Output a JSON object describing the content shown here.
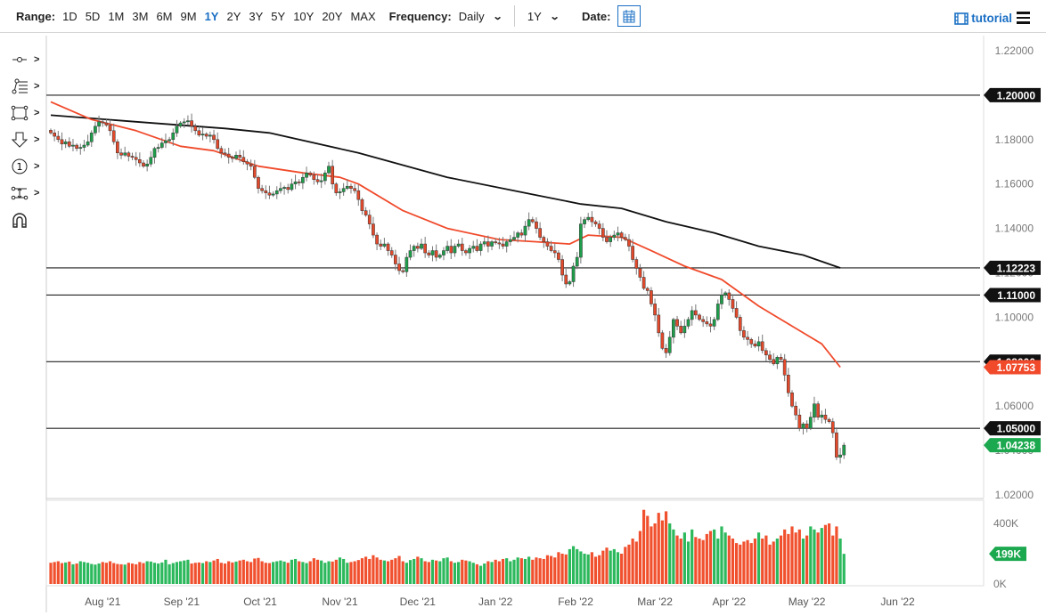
{
  "toolbar": {
    "range_label": "Range:",
    "ranges": [
      "1D",
      "5D",
      "1M",
      "3M",
      "6M",
      "9M",
      "1Y",
      "2Y",
      "3Y",
      "5Y",
      "10Y",
      "20Y",
      "MAX"
    ],
    "selected_range": "1Y",
    "frequency_label": "Frequency:",
    "frequency_value": "Daily",
    "period_value": "1Y",
    "date_label": "Date:",
    "tutorial_label": "tutorial"
  },
  "tools": [
    "line-tool-icon",
    "fibonacci-tool-icon",
    "rectangle-tool-icon",
    "arrow-down-tool-icon",
    "number-marker-icon",
    "measure-tool-icon",
    "magnet-icon"
  ],
  "colors": {
    "up": "#1e9e4a",
    "down": "#e3492b",
    "ma_fast": "#f04a2b",
    "ma_slow": "#111111",
    "accent": "#1a6fc4"
  },
  "chart_data": {
    "type": "candlestick",
    "ylim": [
      1.015,
      1.225
    ],
    "price_ticks": [
      "1.22000",
      "1.20000",
      "1.18000",
      "1.16000",
      "1.14000",
      "1.12000",
      "1.10000",
      "1.08000",
      "1.06000",
      "1.04000",
      "1.02000"
    ],
    "x_labels": [
      {
        "label": "Aug '21",
        "i": 14
      },
      {
        "label": "Sep '21",
        "i": 35.3
      },
      {
        "label": "Oct '21",
        "i": 56.5
      },
      {
        "label": "Nov '21",
        "i": 78
      },
      {
        "label": "Dec '21",
        "i": 99
      },
      {
        "label": "Jan '22",
        "i": 120
      },
      {
        "label": "Feb '22",
        "i": 141.6
      },
      {
        "label": "Mar '22",
        "i": 163
      },
      {
        "label": "Apr '22",
        "i": 183
      },
      {
        "label": "May '22",
        "i": 204
      },
      {
        "label": "Jun '22",
        "i": 228.5
      }
    ],
    "horizontal_lines": [
      {
        "value": 1.2,
        "label": "1.20000"
      },
      {
        "value": 1.12223,
        "label": "1.12223"
      },
      {
        "value": 1.11,
        "label": "1.11000"
      },
      {
        "value": 1.08,
        "label": "1.08000"
      },
      {
        "value": 1.05,
        "label": "1.05000"
      }
    ],
    "ma_fast": {
      "label": "1.07753",
      "points": [
        [
          0,
          1.197
        ],
        [
          11,
          1.189
        ],
        [
          23,
          1.184
        ],
        [
          35,
          1.177
        ],
        [
          44,
          1.175
        ],
        [
          56,
          1.168
        ],
        [
          68,
          1.165
        ],
        [
          78,
          1.163
        ],
        [
          83,
          1.16
        ],
        [
          95,
          1.148
        ],
        [
          107,
          1.14
        ],
        [
          121,
          1.135
        ],
        [
          131,
          1.134
        ],
        [
          140,
          1.133
        ],
        [
          145,
          1.137
        ],
        [
          154,
          1.136
        ],
        [
          162,
          1.13
        ],
        [
          171,
          1.123
        ],
        [
          181,
          1.117
        ],
        [
          191,
          1.105
        ],
        [
          198,
          1.098
        ],
        [
          208,
          1.088
        ],
        [
          213,
          1.0775
        ]
      ]
    },
    "ma_slow": {
      "points": [
        [
          0,
          1.191
        ],
        [
          23,
          1.188
        ],
        [
          47,
          1.185
        ],
        [
          59,
          1.183
        ],
        [
          83,
          1.174
        ],
        [
          107,
          1.163
        ],
        [
          131,
          1.155
        ],
        [
          143,
          1.151
        ],
        [
          154,
          1.149
        ],
        [
          166,
          1.143
        ],
        [
          179,
          1.138
        ],
        [
          191,
          1.132
        ],
        [
          203,
          1.128
        ],
        [
          213,
          1.1222
        ]
      ]
    },
    "last_price": "1.04238",
    "closes": [
      1.183,
      1.1815,
      1.18,
      1.178,
      1.179,
      1.177,
      1.1775,
      1.176,
      1.1765,
      1.1775,
      1.179,
      1.183,
      1.186,
      1.188,
      1.1875,
      1.1865,
      1.184,
      1.179,
      1.174,
      1.173,
      1.174,
      1.1725,
      1.172,
      1.171,
      1.1695,
      1.168,
      1.169,
      1.172,
      1.176,
      1.1765,
      1.1785,
      1.1795,
      1.18,
      1.183,
      1.186,
      1.1875,
      1.188,
      1.1885,
      1.186,
      1.184,
      1.182,
      1.1825,
      1.1815,
      1.182,
      1.18,
      1.176,
      1.174,
      1.1735,
      1.172,
      1.1715,
      1.173,
      1.172,
      1.17,
      1.169,
      1.168,
      1.163,
      1.158,
      1.157,
      1.156,
      1.155,
      1.1555,
      1.157,
      1.158,
      1.1585,
      1.1575,
      1.16,
      1.161,
      1.1605,
      1.163,
      1.165,
      1.164,
      1.162,
      1.161,
      1.1615,
      1.165,
      1.168,
      1.16,
      1.156,
      1.1565,
      1.158,
      1.159,
      1.158,
      1.157,
      1.153,
      1.148,
      1.146,
      1.142,
      1.137,
      1.133,
      1.132,
      1.133,
      1.13,
      1.128,
      1.124,
      1.121,
      1.1205,
      1.127,
      1.13,
      1.132,
      1.131,
      1.133,
      1.129,
      1.128,
      1.13,
      1.127,
      1.128,
      1.13,
      1.132,
      1.129,
      1.132,
      1.133,
      1.13,
      1.129,
      1.131,
      1.132,
      1.13,
      1.133,
      1.134,
      1.132,
      1.134,
      1.1335,
      1.133,
      1.132,
      1.134,
      1.135,
      1.136,
      1.138,
      1.137,
      1.141,
      1.144,
      1.143,
      1.14,
      1.136,
      1.134,
      1.132,
      1.13,
      1.129,
      1.126,
      1.119,
      1.115,
      1.116,
      1.123,
      1.127,
      1.142,
      1.144,
      1.145,
      1.143,
      1.142,
      1.14,
      1.136,
      1.134,
      1.136,
      1.137,
      1.138,
      1.136,
      1.135,
      1.132,
      1.126,
      1.122,
      1.118,
      1.113,
      1.112,
      1.106,
      1.101,
      1.093,
      1.086,
      1.084,
      1.091,
      1.099,
      1.096,
      1.093,
      1.096,
      1.099,
      1.103,
      1.101,
      1.099,
      1.098,
      1.097,
      1.096,
      1.099,
      1.106,
      1.11,
      1.111,
      1.108,
      1.104,
      1.1,
      1.094,
      1.091,
      1.09,
      1.088,
      1.087,
      1.089,
      1.085,
      1.083,
      1.081,
      1.079,
      1.082,
      1.081,
      1.074,
      1.066,
      1.06,
      1.056,
      1.05,
      1.052,
      1.05,
      1.055,
      1.061,
      1.055,
      1.056,
      1.054,
      1.053,
      1.048,
      1.037,
      1.038,
      1.0424
    ],
    "volume": {
      "ticks": [
        "400K",
        "0K"
      ],
      "last_label": "199K",
      "values_k": [
        140,
        145,
        150,
        138,
        142,
        148,
        130,
        135,
        150,
        145,
        140,
        132,
        128,
        135,
        145,
        140,
        150,
        138,
        132,
        130,
        128,
        140,
        135,
        130,
        145,
        138,
        150,
        148,
        140,
        135,
        142,
        160,
        130,
        138,
        145,
        150,
        155,
        160,
        135,
        140,
        142,
        138,
        150,
        145,
        155,
        165,
        140,
        135,
        150,
        142,
        148,
        155,
        160,
        150,
        145,
        168,
        172,
        150,
        140,
        138,
        145,
        150,
        155,
        148,
        140,
        160,
        165,
        150,
        145,
        138,
        150,
        170,
        160,
        155,
        140,
        150,
        148,
        160,
        175,
        165,
        140,
        145,
        150,
        158,
        170,
        180,
        165,
        190,
        175,
        160,
        155,
        150,
        160,
        170,
        185,
        150,
        140,
        158,
        165,
        180,
        170,
        150,
        145,
        160,
        155,
        150,
        170,
        175,
        150,
        140,
        145,
        160,
        155,
        150,
        140,
        130,
        120,
        135,
        150,
        145,
        160,
        150,
        165,
        170,
        150,
        160,
        175,
        170,
        165,
        180,
        160,
        175,
        170,
        165,
        190,
        185,
        175,
        210,
        200,
        195,
        230,
        250,
        230,
        215,
        200,
        195,
        210,
        180,
        190,
        220,
        240,
        220,
        230,
        210,
        200,
        245,
        260,
        300,
        280,
        350,
        490,
        450,
        380,
        400,
        470,
        420,
        480,
        400,
        360,
        320,
        300,
        340,
        280,
        360,
        310,
        300,
        290,
        330,
        350,
        360,
        300,
        380,
        340,
        320,
        300,
        270,
        260,
        280,
        290,
        270,
        300,
        340,
        300,
        320,
        260,
        280,
        300,
        320,
        360,
        330,
        380,
        340,
        360,
        300,
        320,
        380,
        360,
        340,
        370,
        390,
        400,
        320,
        380,
        300,
        199
      ]
    }
  }
}
